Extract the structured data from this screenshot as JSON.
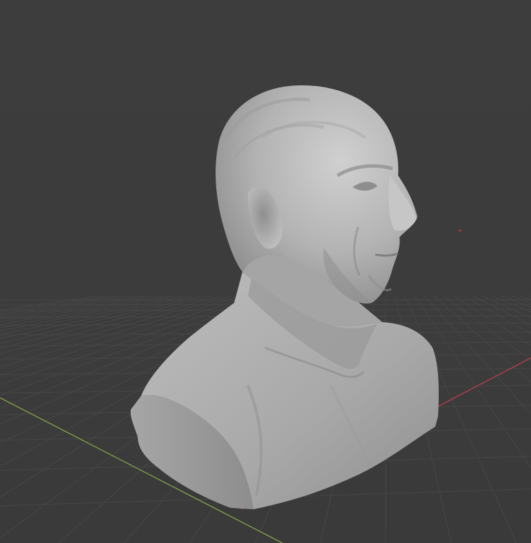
{
  "viewport": {
    "object_kind": "bust-sculpt-mesh",
    "colors": {
      "background": "#3d3d3d",
      "grid_line": "#474747",
      "x_axis": "#b0404a",
      "y_axis": "#7da247",
      "mesh": "#a9a9a9",
      "mesh_light": "#cfcfcf",
      "mesh_shadow": "#7d7d7d",
      "origin_point": "#c0392b"
    }
  }
}
